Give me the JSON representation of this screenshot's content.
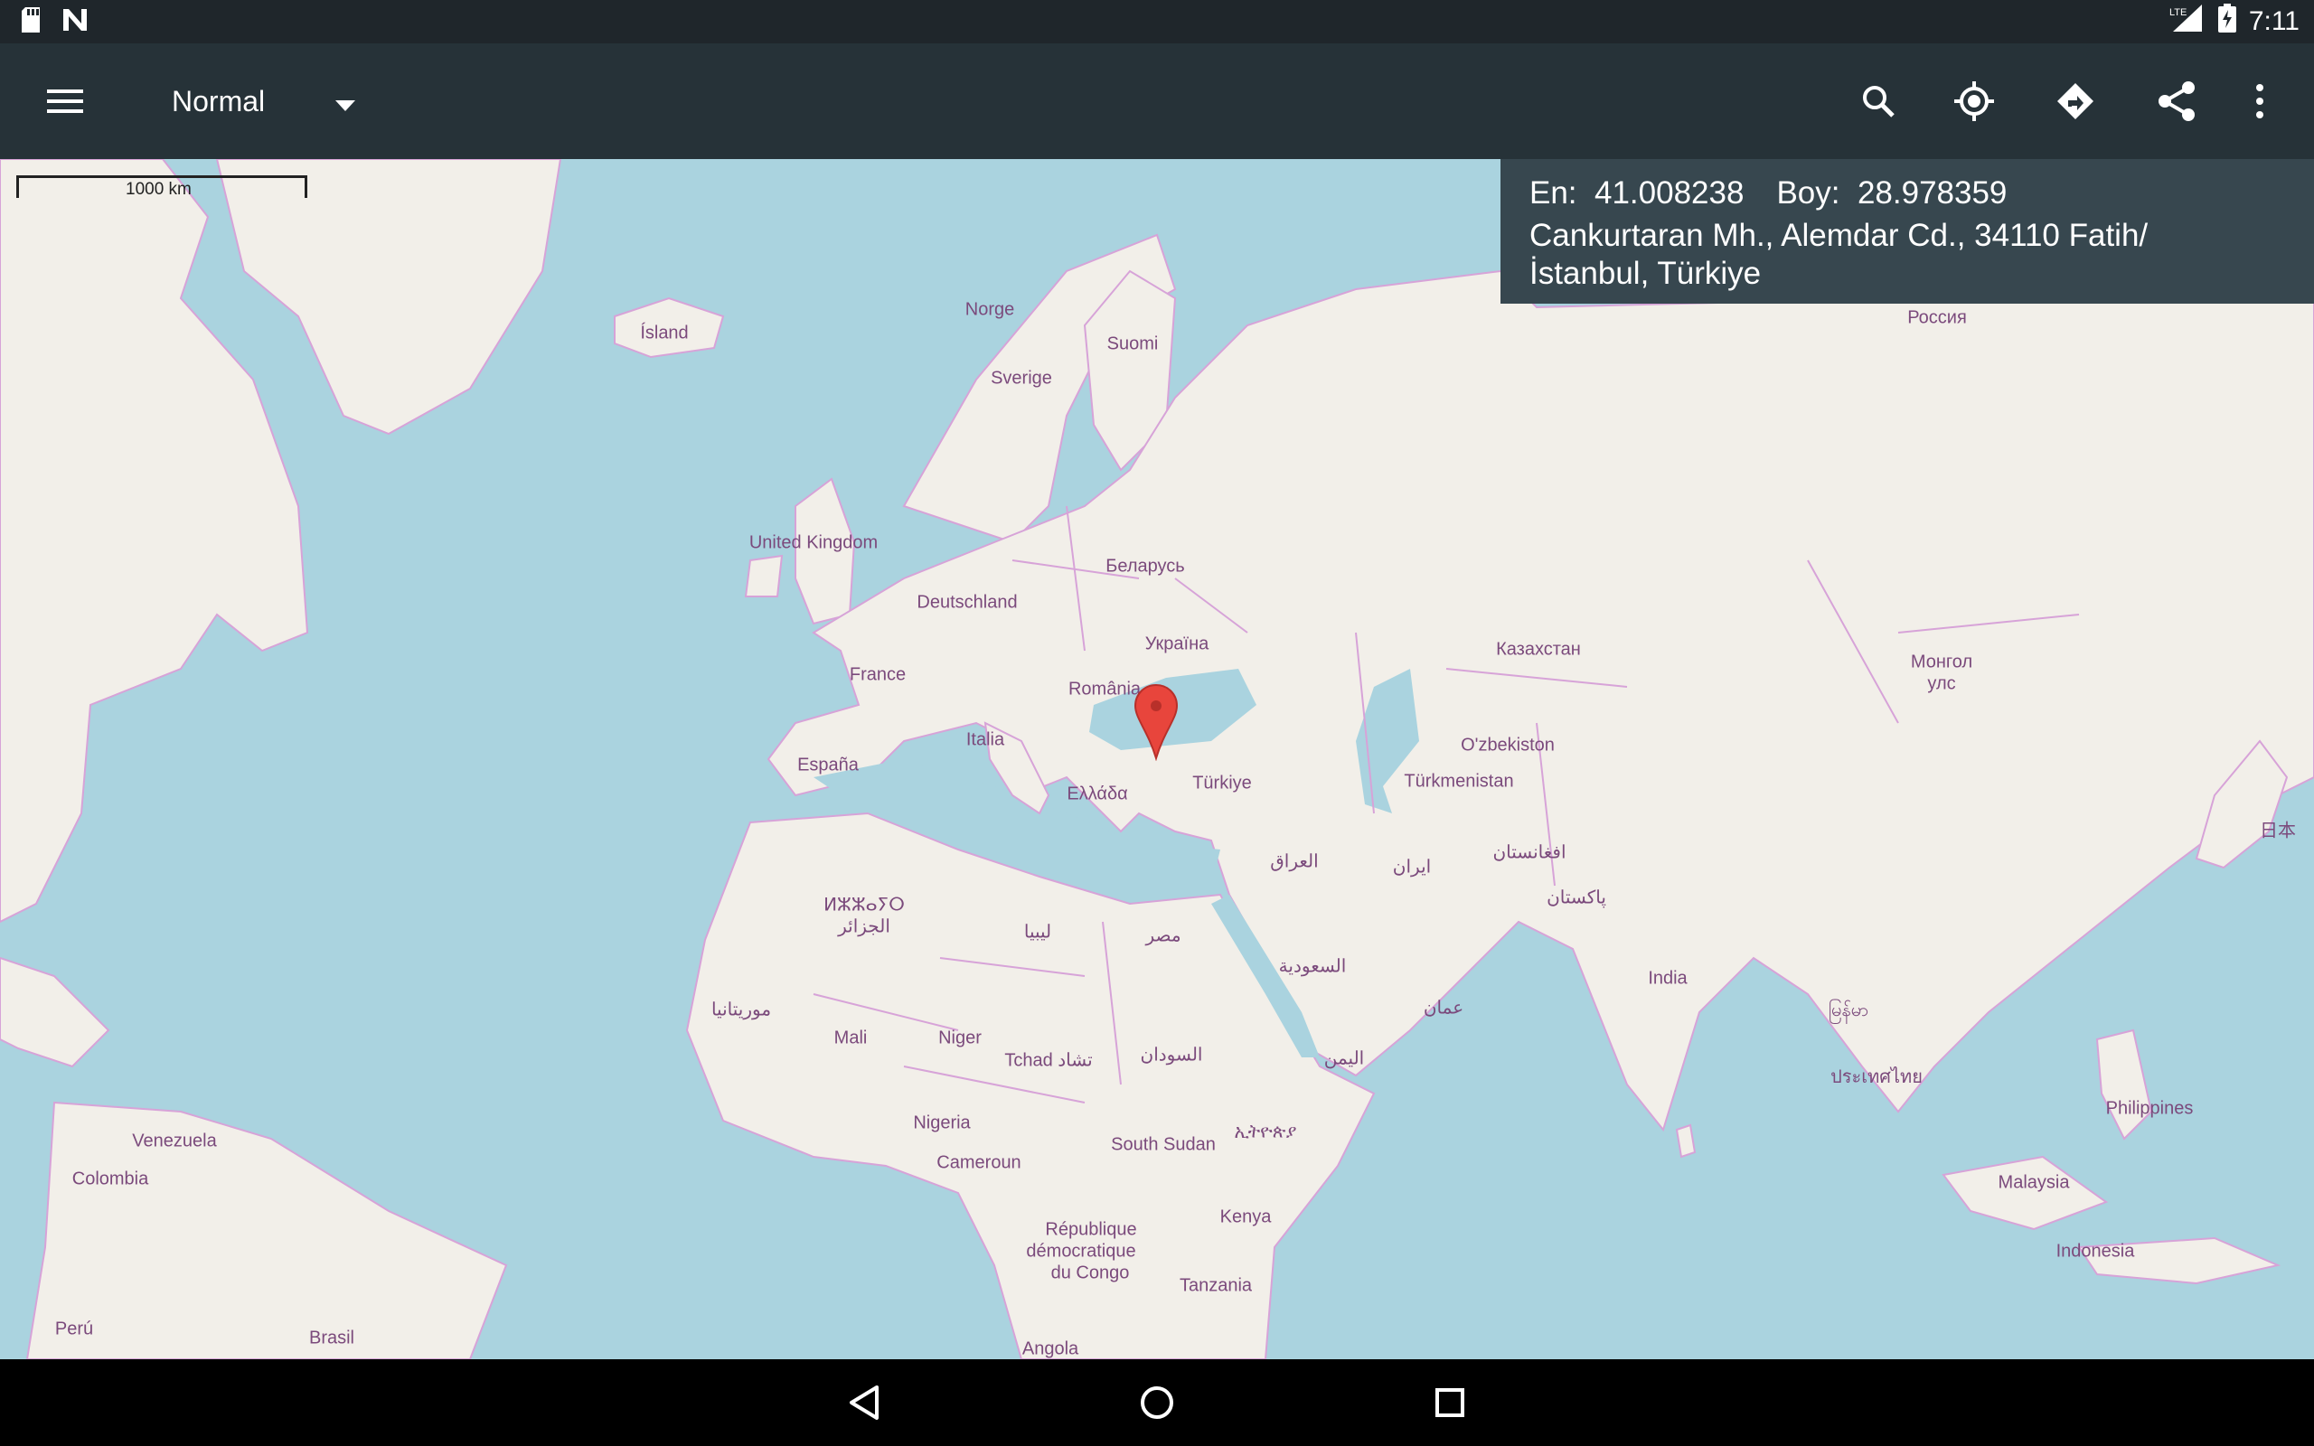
{
  "status_bar": {
    "time": "7:11",
    "network": "LTE",
    "icons": [
      "sd-card-icon",
      "n-notification-icon",
      "signal-icon",
      "battery-charging-icon"
    ]
  },
  "toolbar": {
    "menu_icon": "hamburger-menu-icon",
    "map_type": "Normal",
    "actions": [
      "search-icon",
      "my-location-icon",
      "directions-icon",
      "share-icon",
      "more-vert-icon"
    ]
  },
  "info_panel": {
    "lat_label": "En:",
    "lat_value": "41.008238",
    "lon_label": "Boy:",
    "lon_value": "28.978359",
    "address_line1": "Cankurtaran Mh., Alemdar Cd., 34110 Fatih/",
    "address_line2": "İstanbul, Türkiye"
  },
  "scale": {
    "label": "1000 km"
  },
  "map": {
    "colors": {
      "water": "#aad3df",
      "land": "#f2efe9",
      "border": "#d7a3d8",
      "label": "#7b4a7c",
      "marker": "#e8453c"
    },
    "labels": [
      "Ísland",
      "Norge",
      "Suomi",
      "Sverige",
      "Россия",
      "United Kingdom",
      "Беларусь",
      "Deutschland",
      "Україна",
      "France",
      "România",
      "Казахстан",
      "Монгол",
      "улс",
      "Italia",
      "O'zbekiston",
      "España",
      "Türkmenistan",
      "Türkiye",
      "Ελλάδα",
      "العراق",
      "ایران",
      "افغانستان",
      "ⵍⵣⵣⴰⵢⵔ",
      "الجزائر",
      "ليبيا",
      "مصر",
      "پاکستان",
      "日本",
      "السعودية",
      "India",
      "موريتانيا",
      "Mali",
      "Niger",
      "Tchad تشاد",
      "السودان",
      "عمان",
      "اليمن",
      "ประเทศไทย",
      "Venezuela",
      "Nigeria",
      "ኢትዮጵያ",
      "Philippines",
      "Colombia",
      "Cameroun",
      "South Sudan",
      "Malaysia",
      "République",
      "démocratique",
      "du Congo",
      "Kenya",
      "Indonesia",
      "Tanzania",
      "Perú",
      "Brasil",
      "Angola",
      "မြန်မာ"
    ]
  },
  "nav_bar": {
    "buttons": [
      "back-icon",
      "home-icon",
      "recents-icon"
    ]
  }
}
